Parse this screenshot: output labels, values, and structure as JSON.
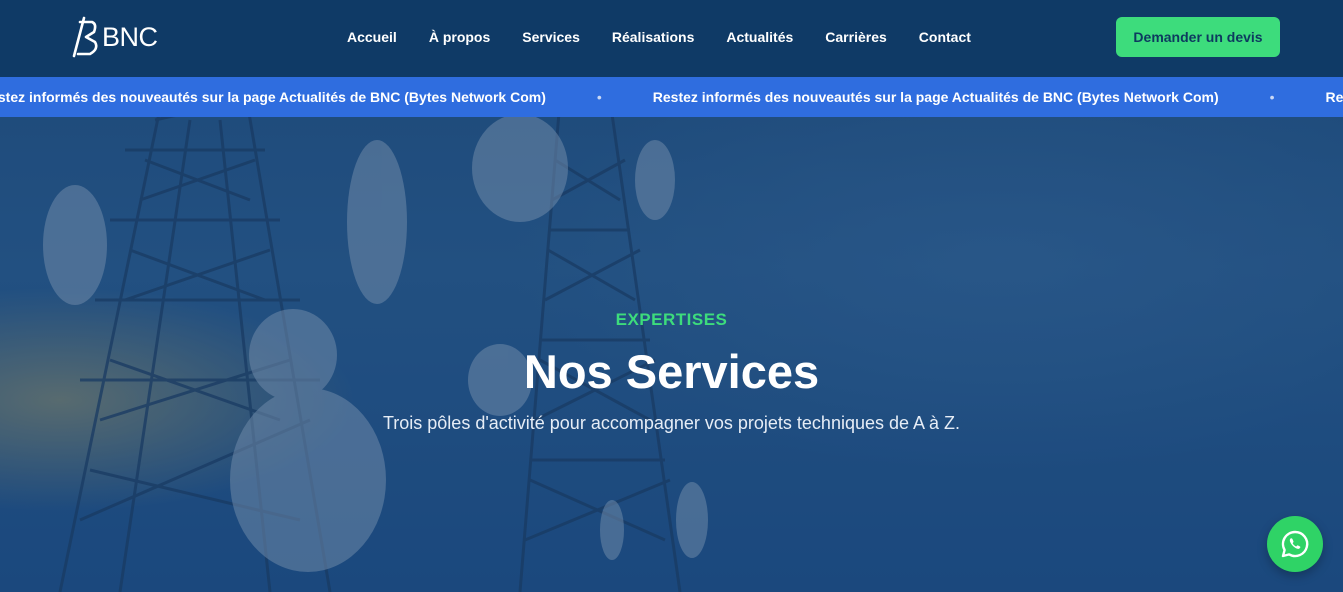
{
  "brand": {
    "name": "BNC"
  },
  "nav": {
    "items": [
      {
        "label": "Accueil"
      },
      {
        "label": "À propos"
      },
      {
        "label": "Services"
      },
      {
        "label": "Réalisations"
      },
      {
        "label": "Actualités"
      },
      {
        "label": "Carrières"
      },
      {
        "label": "Contact"
      }
    ],
    "cta_label": "Demander un devis"
  },
  "ticker": {
    "message": "Restez informés des nouveautés sur la page Actualités de BNC (Bytes Network Com)",
    "separator": "•"
  },
  "hero": {
    "eyebrow": "EXPERTISES",
    "title": "Nos Services",
    "subtitle": "Trois pôles d'activité pour accompagner vos projets techniques de A à Z."
  },
  "colors": {
    "header_bg": "#0f3a66",
    "ticker_bg": "#2f6ddf",
    "accent_green": "#3ddc7c",
    "whatsapp_green": "#2fd366"
  },
  "icons": {
    "whatsapp": "whatsapp-icon",
    "logo": "bnc-logo-mark"
  }
}
